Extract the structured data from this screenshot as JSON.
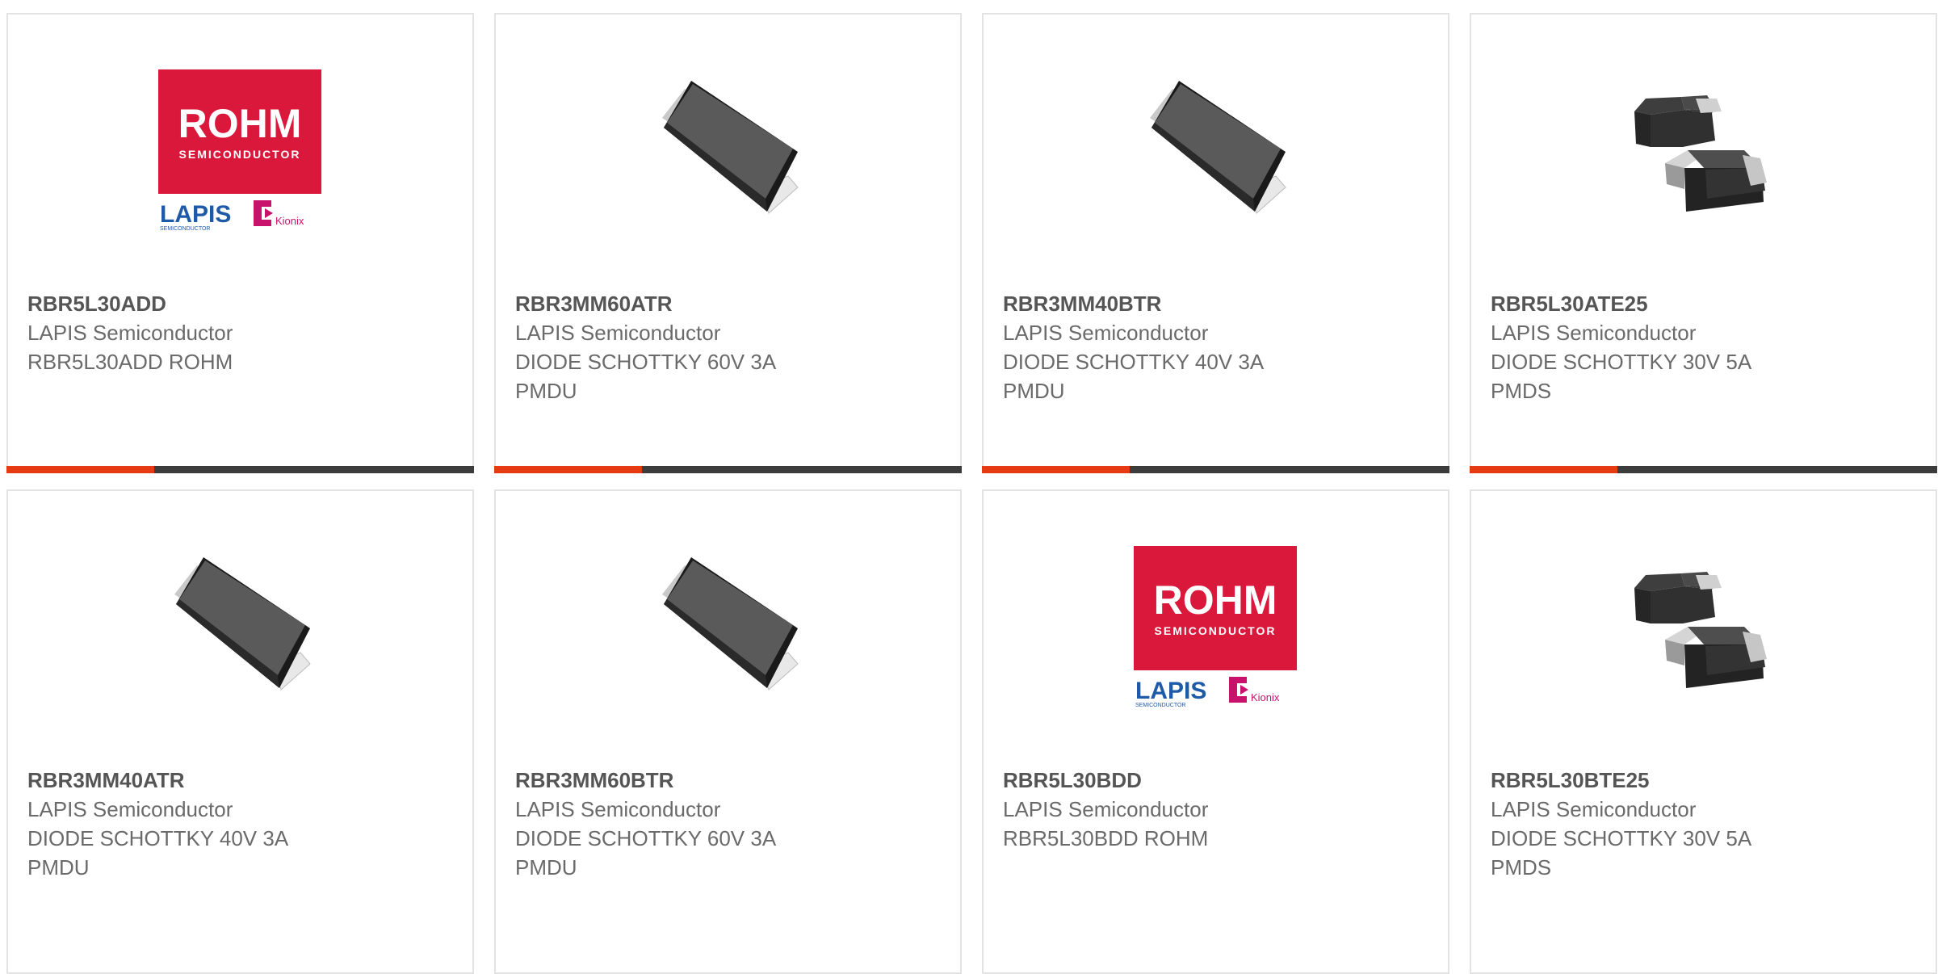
{
  "colors": {
    "accent": "#e63a12",
    "bar_dark": "#3c3c3c",
    "rohm_red": "#d9183b",
    "lapis_blue": "#1f5aa8",
    "kionix_magenta": "#c8126c",
    "border": "#e3e3e3"
  },
  "products": [
    {
      "part_number": "RBR5L30ADD",
      "manufacturer": "LAPIS Semiconductor",
      "desc1": "RBR5L30ADD ROHM",
      "desc2": "",
      "image": "rohm-lapis-kionix-logo",
      "logo": {
        "rohm": "ROHM",
        "rohm_sub": "SEMICONDUCTOR",
        "lapis": "LAPIS",
        "lapis_sub": "SEMICONDUCTOR",
        "kionix": "Kionix"
      }
    },
    {
      "part_number": "RBR3MM60ATR",
      "manufacturer": "LAPIS Semiconductor",
      "desc1": "DIODE SCHOTTKY 60V 3A",
      "desc2": "PMDU",
      "image": "pmdu-package-icon"
    },
    {
      "part_number": "RBR3MM40BTR",
      "manufacturer": "LAPIS Semiconductor",
      "desc1": "DIODE SCHOTTKY 40V 3A",
      "desc2": "PMDU",
      "image": "pmdu-package-icon"
    },
    {
      "part_number": "RBR5L30ATE25",
      "manufacturer": "LAPIS Semiconductor",
      "desc1": "DIODE SCHOTTKY 30V 5A",
      "desc2": "PMDS",
      "image": "pmds-package-icon"
    },
    {
      "part_number": "RBR3MM40ATR",
      "manufacturer": "LAPIS Semiconductor",
      "desc1": "DIODE SCHOTTKY 40V 3A",
      "desc2": "PMDU",
      "image": "pmdu-package-icon"
    },
    {
      "part_number": "RBR3MM60BTR",
      "manufacturer": "LAPIS Semiconductor",
      "desc1": "DIODE SCHOTTKY 60V 3A",
      "desc2": "PMDU",
      "image": "pmdu-package-icon"
    },
    {
      "part_number": "RBR5L30BDD",
      "manufacturer": "LAPIS Semiconductor",
      "desc1": "RBR5L30BDD ROHM",
      "desc2": "",
      "image": "rohm-lapis-kionix-logo",
      "logo": {
        "rohm": "ROHM",
        "rohm_sub": "SEMICONDUCTOR",
        "lapis": "LAPIS",
        "lapis_sub": "SEMICONDUCTOR",
        "kionix": "Kionix"
      }
    },
    {
      "part_number": "RBR5L30BTE25",
      "manufacturer": "LAPIS Semiconductor",
      "desc1": "DIODE SCHOTTKY 30V 5A",
      "desc2": "PMDS",
      "image": "pmds-package-icon"
    }
  ]
}
